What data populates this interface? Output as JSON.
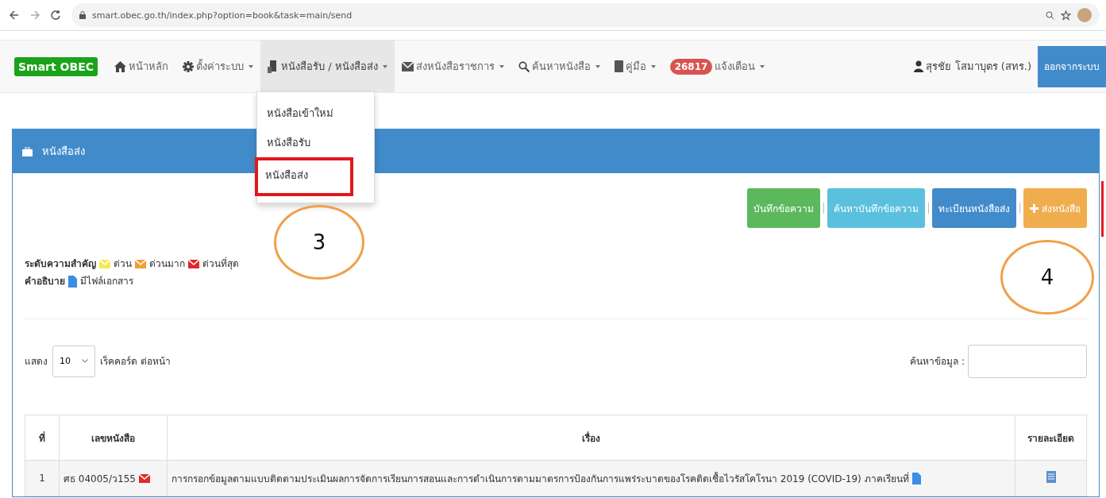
{
  "browser": {
    "url": "smart.obec.go.th/index.php?option=book&task=main/send"
  },
  "navbar": {
    "brand": "Smart OBEC",
    "items": [
      {
        "label": "หน้าหลัก",
        "caret": false,
        "selected": false
      },
      {
        "label": "ตั้งค่าระบบ",
        "caret": true,
        "selected": false
      },
      {
        "label": "หนังสือรับ / หนังสือส่ง",
        "caret": true,
        "selected": true
      },
      {
        "label": "ส่งหนังสือราชการ",
        "caret": true,
        "selected": false
      },
      {
        "label": "ค้นหาหนังสือ",
        "caret": true,
        "selected": false
      },
      {
        "label": "คู่มือ",
        "caret": true,
        "selected": false
      }
    ],
    "notifications": {
      "badge": "26817",
      "label": "แจ้งเตือน"
    },
    "user": "สุรชัย โสมาบุตร (สทร.)",
    "logout": "ออกจากระบบ"
  },
  "dropdown": {
    "items": [
      {
        "label": "หนังสือเข้าใหม่",
        "outlined": false
      },
      {
        "label": "หนังสือรับ",
        "outlined": false
      },
      {
        "label": "หนังสือส่ง",
        "outlined": true
      }
    ]
  },
  "panel": {
    "title": "หนังสือส่ง",
    "buttons": [
      {
        "label": "บันทึกข้อความ",
        "kind": "success"
      },
      {
        "label": "ค้นหาบันทึกข้อความ",
        "kind": "info"
      },
      {
        "label": "ทะเบียนหนังสือส่ง",
        "kind": "primary"
      },
      {
        "label": "ส่งหนังสือ",
        "kind": "warning"
      }
    ],
    "legend": {
      "title": "ระดับความสำคัญ",
      "levels": [
        {
          "label": "ด่วน",
          "color": "#f7e85a"
        },
        {
          "label": "ด่วนมาก",
          "color": "#f0a030"
        },
        {
          "label": "ด่วนที่สุด",
          "color": "#dd2a2a"
        }
      ],
      "note_title": "คำอธิบาย",
      "note": "มีไฟล์เอกสาร"
    },
    "length": {
      "before": "แสดง",
      "value": "10",
      "after": "เร็คคอร์ด ต่อหน้า"
    },
    "search": {
      "label": "ค้นหาข้อมูล :"
    },
    "table": {
      "columns": [
        "ที่",
        "เลขหนังสือ",
        "เรื่อง",
        "รายละเอียด"
      ],
      "rows": [
        {
          "no": "1",
          "number": "ศธ 04005/ว155",
          "color": "#dd2a2a",
          "subject": "การกรอกข้อมูลตามแบบติดตามประเมินผลการจัดการเรียนการสอนและการดำเนินการตามมาตรการป้องกันการแพร่ระบาดของโรคติดเชื้อไวรัสโคโรนา 2019 (COVID-19) ภาคเรียนที่",
          "attachment": true
        }
      ]
    }
  },
  "annotations": [
    {
      "label": "3"
    },
    {
      "label": "4"
    }
  ]
}
